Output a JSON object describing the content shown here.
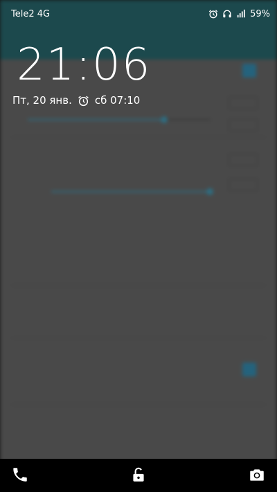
{
  "status_bar": {
    "carrier": "Tele2 4G",
    "battery": "59%",
    "icons": [
      "alarm-icon",
      "headset-icon",
      "signal-icon",
      "battery-icon"
    ]
  },
  "lockscreen": {
    "time": "21:06",
    "date": "Пт, 20 янв.",
    "next_alarm": "сб 07:10"
  },
  "bottom_bar": {
    "icons": [
      "phone-icon",
      "unlock-icon",
      "camera-icon"
    ]
  },
  "colors": {
    "toolbar": "#245e63",
    "accent": "#2f7fa0",
    "bottom_bar": "#000000"
  }
}
